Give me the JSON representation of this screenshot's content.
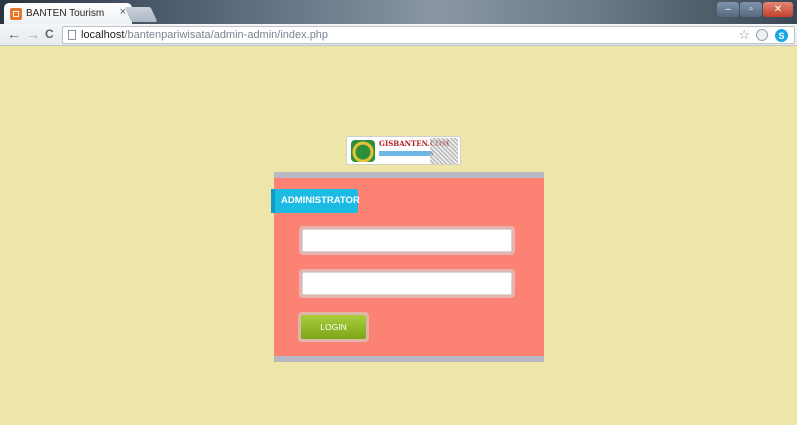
{
  "browser": {
    "tab_title": "BANTEN Tourism",
    "tab_close": "×",
    "url_host": "localhost",
    "url_path": "/bantenpariwisata/admin-admin/index.php",
    "nav": {
      "back": "←",
      "forward": "→",
      "reload": "C"
    },
    "star": "☆",
    "ext_badge": "S"
  },
  "page": {
    "logo_text": "GISBANTEN.COM",
    "panel_title": "ADMINISTRATOR",
    "username_value": "",
    "password_value": "",
    "login_label": "LOGIN"
  },
  "colors": {
    "page_bg": "#eee5a8",
    "panel_bg": "#fc8373",
    "accent_tag": "#1cbbe4",
    "login_button": "#8fb628"
  }
}
